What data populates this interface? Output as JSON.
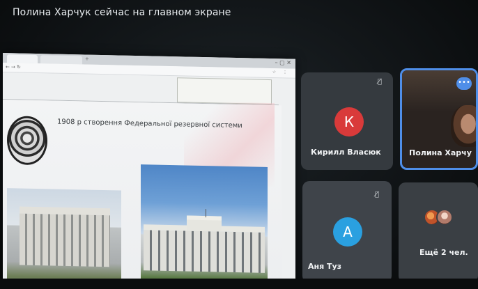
{
  "meeting": {
    "presenter_banner": "Полина Харчук сейчас на главном экране"
  },
  "shared_screen": {
    "slide_caption": "1908 р створення Федеральної резервної системи"
  },
  "participants": [
    {
      "name": "Кирилл Власюк",
      "initial": "К",
      "avatar_color": "#d93a3a",
      "mic_muted": true
    },
    {
      "name": "Полина Харчу",
      "initial": "",
      "active_speaker": true,
      "camera_on": true
    },
    {
      "name": "Аня Туз",
      "initial": "А",
      "avatar_color": "#2aa0e0",
      "mic_muted": true
    },
    {
      "name": "Ещё 2 чел.",
      "initial": ""
    }
  ],
  "colors": {
    "active_border": "#4f8ee8",
    "tile_bg": "#3b4045"
  },
  "icons": {
    "mic_off": "mic-off-icon",
    "more": "more-options-icon"
  }
}
